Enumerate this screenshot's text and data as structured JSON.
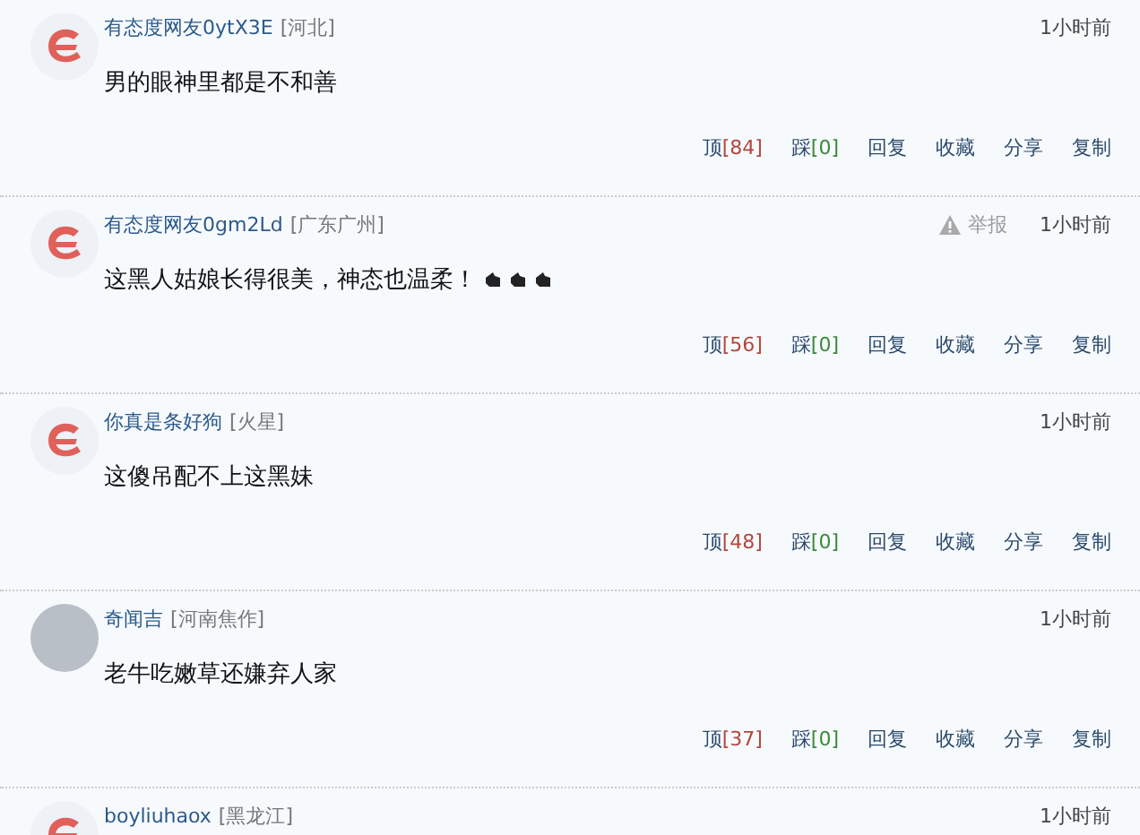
{
  "comments": [
    {
      "avatar": {
        "kind": "logo"
      },
      "user": "有态度网友0ytX3E",
      "location": "[河北]",
      "time": "1小时前",
      "text": "男的眼神里都是不和善",
      "actions": {
        "up_label": "顶",
        "up_count": "[84]",
        "down_label": "踩",
        "down_count": "[0]",
        "reply": "回复",
        "favorite": "收藏",
        "share": "分享",
        "copy": "复制"
      }
    },
    {
      "avatar": {
        "kind": "logo"
      },
      "user": "有态度网友0gm2Ld",
      "location": "[广东广州]",
      "report": "举报",
      "time": "1小时前",
      "text": "这黑人姑娘长得很美，神态也温柔！",
      "emoticons": [
        {
          "kind": "hand"
        },
        {
          "kind": "hand"
        },
        {
          "kind": "hand"
        }
      ],
      "actions": {
        "up_label": "顶",
        "up_count": "[56]",
        "down_label": "踩",
        "down_count": "[0]",
        "reply": "回复",
        "favorite": "收藏",
        "share": "分享",
        "copy": "复制"
      }
    },
    {
      "avatar": {
        "kind": "logo"
      },
      "user": "你真是条好狗",
      "location": "[火星]",
      "time": "1小时前",
      "text": "这傻吊配不上这黑妹",
      "actions": {
        "up_label": "顶",
        "up_count": "[48]",
        "down_label": "踩",
        "down_count": "[0]",
        "reply": "回复",
        "favorite": "收藏",
        "share": "分享",
        "copy": "复制"
      }
    },
    {
      "avatar": {
        "kind": "photo"
      },
      "user": "奇闻吉",
      "location": "[河南焦作]",
      "time": "1小时前",
      "text": "老牛吃嫩草还嫌弃人家",
      "actions": {
        "up_label": "顶",
        "up_count": "[37]",
        "down_label": "踩",
        "down_count": "[0]",
        "reply": "回复",
        "favorite": "收藏",
        "share": "分享",
        "copy": "复制"
      }
    },
    {
      "avatar": {
        "kind": "logo"
      },
      "user": "boyliuhaox",
      "location": "[黑龙江]",
      "time": "1小时前"
    }
  ]
}
